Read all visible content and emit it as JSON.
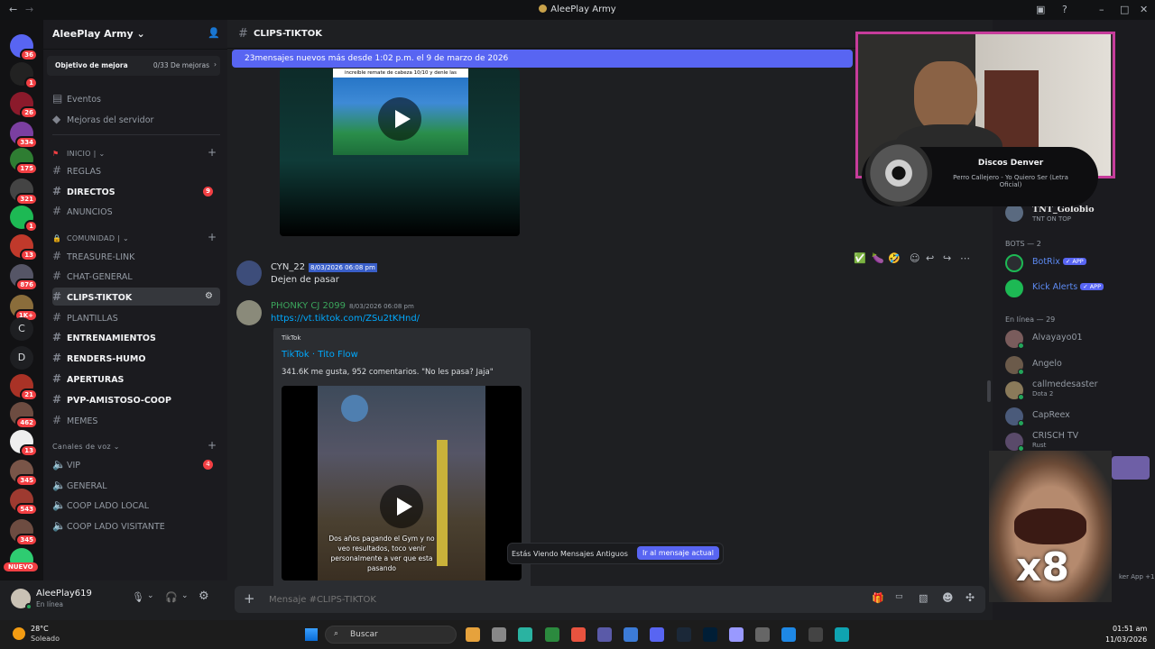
{
  "window": {
    "title": "AleePlay Army"
  },
  "servers": [
    {
      "badge": "36",
      "color": "#5865f2"
    },
    {
      "badge": "1",
      "color": "#222"
    },
    {
      "badge": "26",
      "color": "#8b1a2b"
    },
    {
      "badge": "334",
      "color": "#7b3fa0"
    },
    {
      "badge": "175",
      "color": "#2e7d32"
    },
    {
      "badge": "321",
      "color": "#444"
    },
    {
      "badge": "1",
      "color": "#1db954"
    },
    {
      "badge": "13",
      "color": "#c0392b"
    },
    {
      "badge": "876",
      "color": "#556"
    },
    {
      "badge": "1K+",
      "color": "#8a6d3b"
    }
  ],
  "servers_letters": [
    "C",
    "D"
  ],
  "servers_lower": [
    {
      "badge": "21",
      "color": "#a93226"
    },
    {
      "badge": "462",
      "color": "#6d4c41"
    },
    {
      "badge": "13",
      "color": "#eee"
    },
    {
      "badge": "345",
      "color": "#795548"
    },
    {
      "badge": "543",
      "color": "#9e3a30"
    },
    {
      "badge": "345",
      "color": "#6d4c41"
    },
    {
      "badge": "",
      "color": "#2ecc71"
    }
  ],
  "new_badge": "NUEVO",
  "sidebar": {
    "server_name": "AleePlay Army",
    "boost_label": "Objetivo de mejora",
    "boost_value": "0/33 De mejoras",
    "events": "Eventos",
    "boosts": "Mejoras del servidor",
    "cat_inicio": "INICIO |",
    "cat_comunidad": "COMUNIDAD |",
    "voice_cat": "Canales de voz",
    "text_channels": [
      {
        "name": "REGLAS",
        "style": "dim",
        "badge": ""
      },
      {
        "name": "DIRECTOS",
        "style": "bold",
        "badge": "9"
      },
      {
        "name": "ANUNCIOS",
        "style": "dim",
        "badge": ""
      },
      {
        "name": "TREASURE-LINK",
        "style": "dim",
        "badge": ""
      },
      {
        "name": "CHAT-GENERAL",
        "style": "dim",
        "badge": ""
      },
      {
        "name": "CLIPS-TIKTOK",
        "style": "sel",
        "badge": ""
      },
      {
        "name": "PLANTILLAS",
        "style": "dim",
        "badge": ""
      },
      {
        "name": "ENTRENAMIENTOS",
        "style": "bold",
        "badge": ""
      },
      {
        "name": "RENDERS-HUMO",
        "style": "bold",
        "badge": ""
      },
      {
        "name": "APERTURAS",
        "style": "bold",
        "badge": ""
      },
      {
        "name": "PVP-AMISTOSO-COOP",
        "style": "bold",
        "badge": ""
      },
      {
        "name": "MEMES",
        "style": "dim",
        "badge": ""
      }
    ],
    "voice_channels": [
      {
        "name": "VIP",
        "badge": "4"
      },
      {
        "name": "GENERAL",
        "badge": ""
      },
      {
        "name": "COOP LADO LOCAL",
        "badge": ""
      },
      {
        "name": "COOP LADO VISITANTE",
        "badge": ""
      }
    ]
  },
  "user": {
    "name": "AleePlay619",
    "status": "En línea"
  },
  "main": {
    "channel": "CLIPS-TIKTOK",
    "new_messages": "23mensajes nuevos más desde 1:02 p.m. el 9 de marzo de 2026",
    "video1_caption": "increíble remate de cabeza 10/10 y denle las",
    "msg1": {
      "author": "CYN_22",
      "time": "8/03/2026 06:08 pm",
      "text": "Dejen de pasar",
      "color": "#dbdee1"
    },
    "msg2": {
      "author": "PHONKY CJ 2099",
      "time": "8/03/2026 06:08 pm",
      "text": "https://vt.tiktok.com/ZSu2tKHnd/",
      "color": "#3ba55c"
    },
    "embed": {
      "provider": "TikTok",
      "title": "TikTok · Tito Flow",
      "desc": "341.6K me gusta, 952 comentarios. \"No les pasa? Jaja\"",
      "overlay": "Dos años pagando el Gym y no veo resultados, toco venir personalmente a ver que esta pasando"
    },
    "old_messages": "Estás Viendo Mensajes Antiguos",
    "jump": "Ir al mensaje actual",
    "placeholder": "Mensaje #CLIPS-TIKTOK"
  },
  "overlay": {
    "track_artist": "Discos Denver",
    "track_title": "Perro Callejero - Yo Quiero Ser (Letra Oficial)",
    "meme_text": "x8"
  },
  "members": {
    "top": {
      "name": "TNT_Golobio",
      "sub": "TNT ON TOP"
    },
    "bots_header": "BOTS — 2",
    "bots": [
      {
        "name": "BotRix",
        "tag": "✓ APP"
      },
      {
        "name": "Kick Alerts",
        "tag": "✓ APP"
      }
    ],
    "online_header": "En línea — 29",
    "online": [
      {
        "name": "Alvayayo01",
        "sub": ""
      },
      {
        "name": "Angelo",
        "sub": ""
      },
      {
        "name": "callmedesaster",
        "sub": "Dota 2"
      },
      {
        "name": "CapReex",
        "sub": ""
      },
      {
        "name": "CRISCH TV",
        "sub": "Rust"
      }
    ],
    "partial": "ker App +1"
  },
  "taskbar": {
    "temp": "28°C",
    "weather": "Soleado",
    "search": "Buscar",
    "time": "01:51 am",
    "date": "11/03/2026"
  }
}
